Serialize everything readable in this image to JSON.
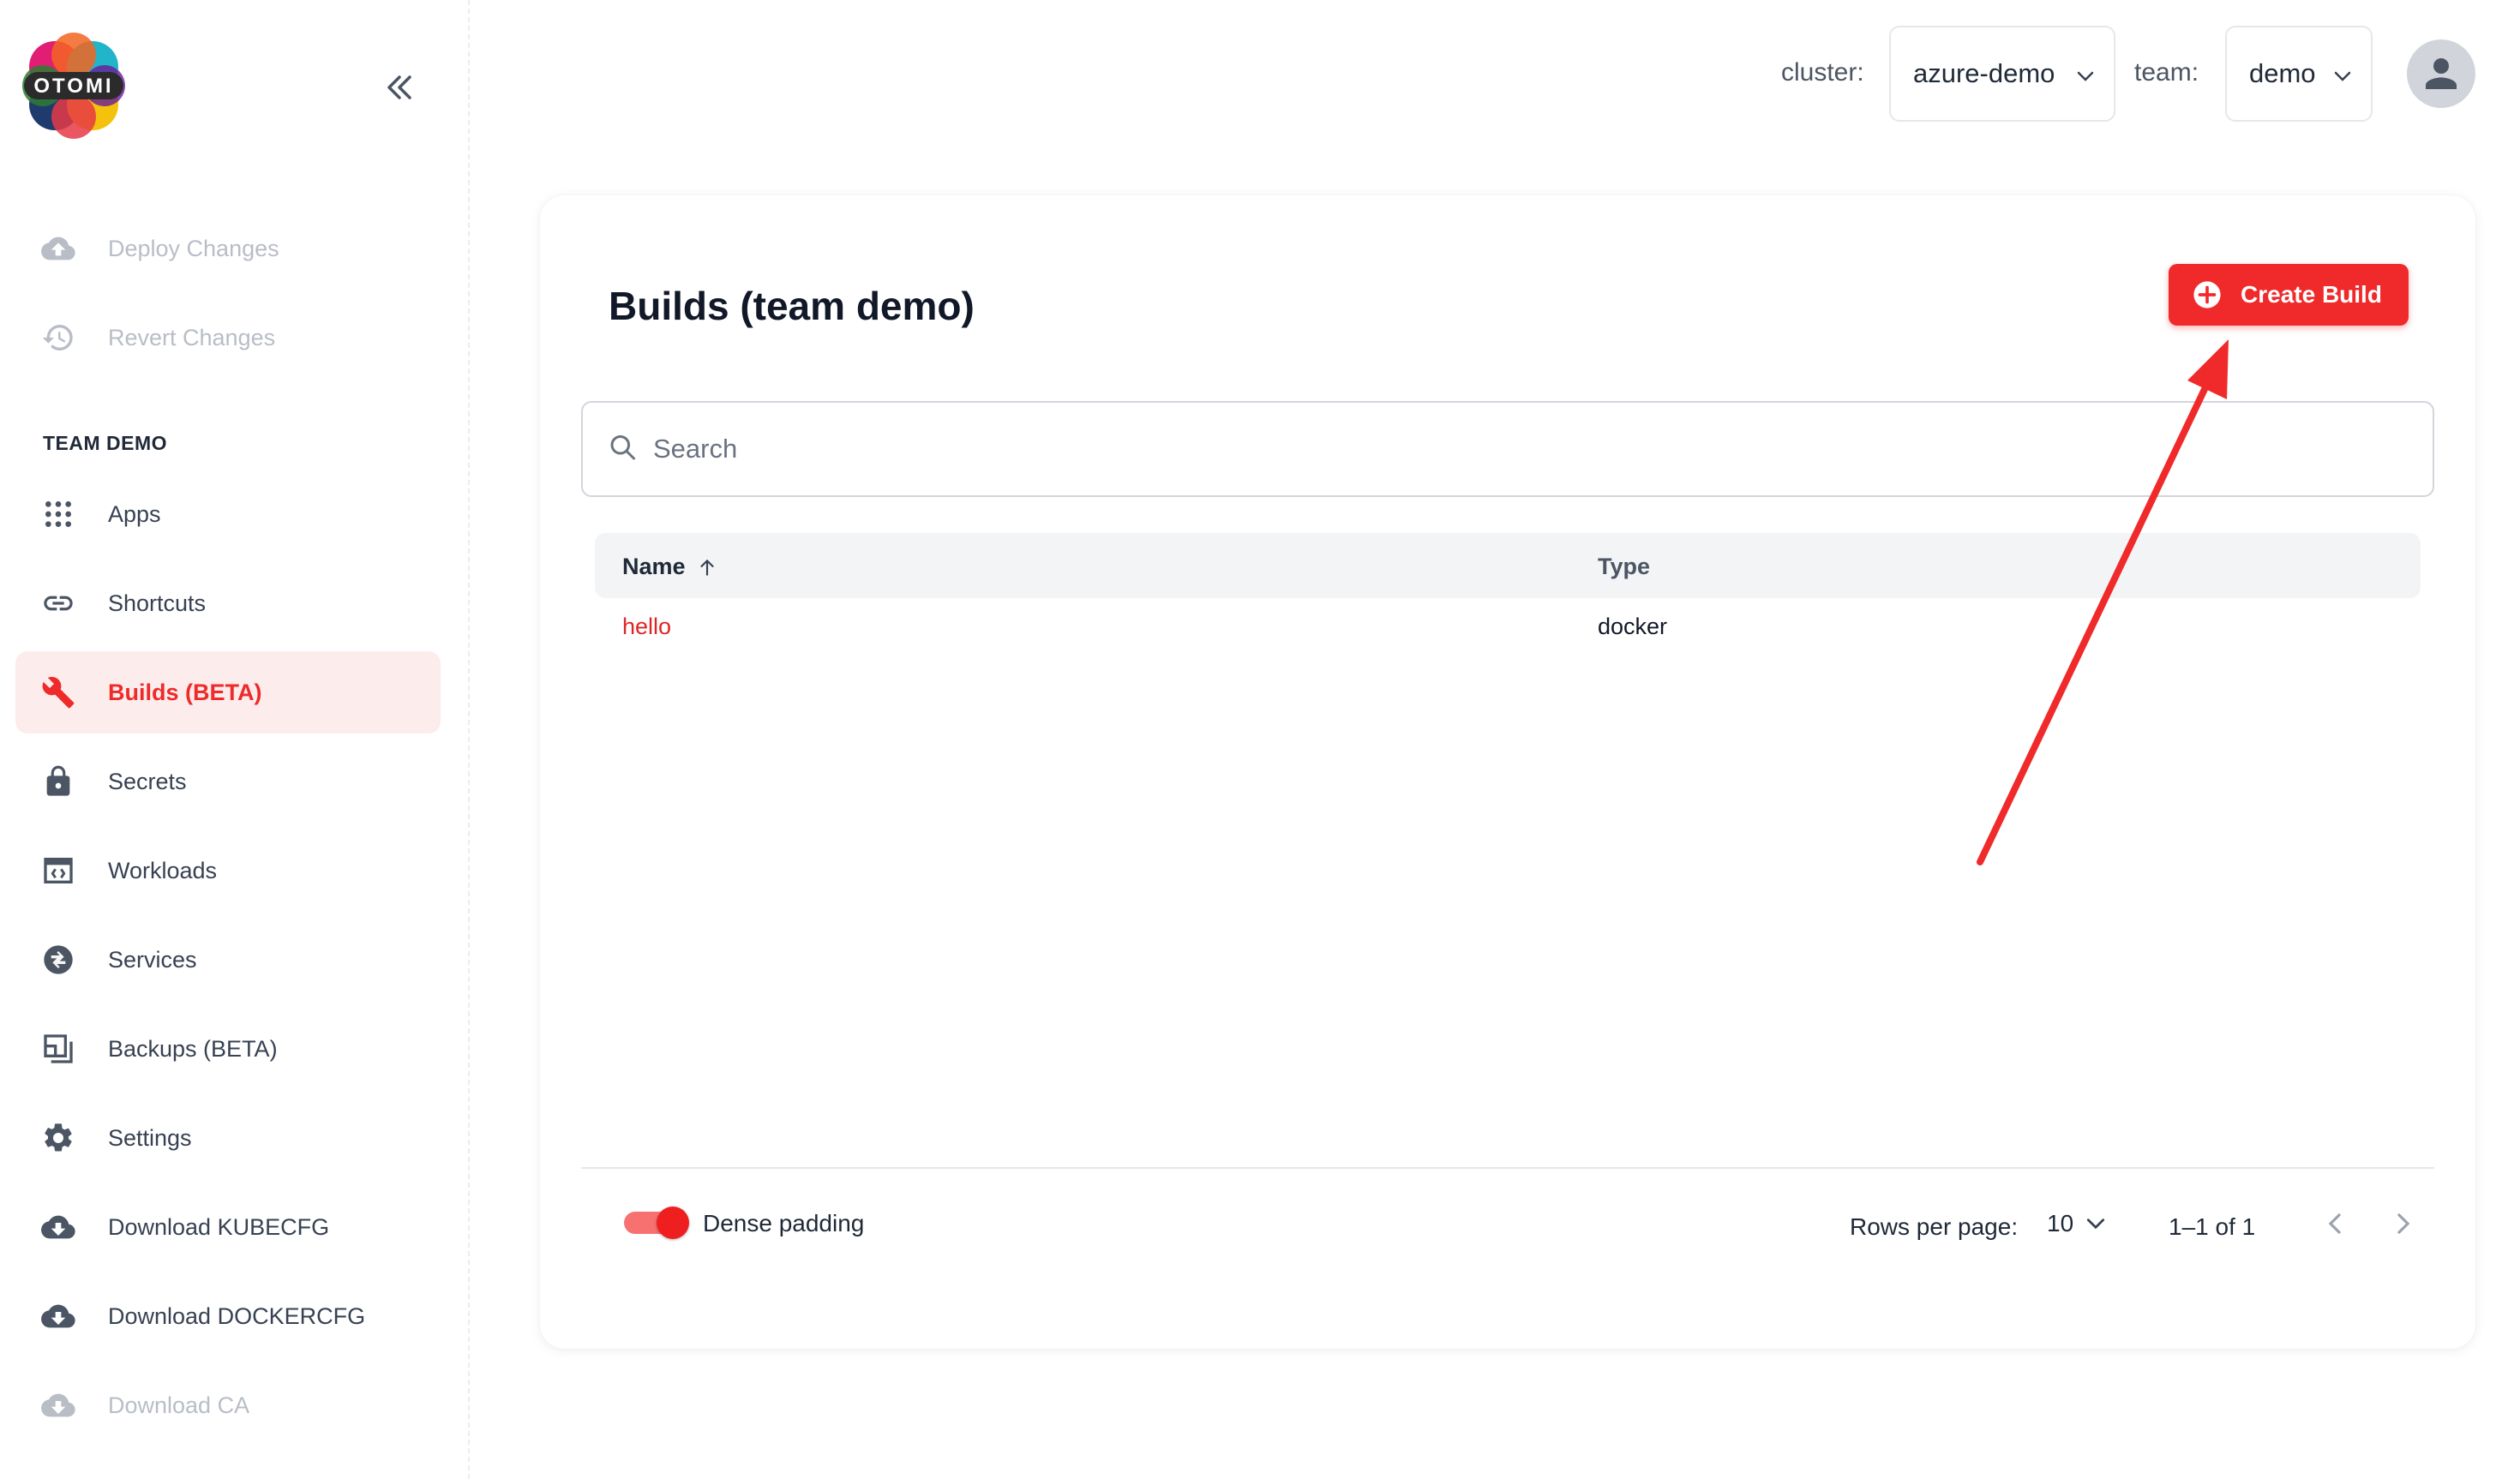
{
  "app": {
    "logo_text": "OTOMI"
  },
  "sidebar": {
    "top_items": [
      {
        "label": "Deploy Changes",
        "icon": "cloud-upload-icon"
      },
      {
        "label": "Revert Changes",
        "icon": "history-icon"
      }
    ],
    "section_label": "TEAM DEMO",
    "items": [
      {
        "label": "Apps",
        "icon": "apps-grid-icon"
      },
      {
        "label": "Shortcuts",
        "icon": "link-icon"
      },
      {
        "label": "Builds (BETA)",
        "icon": "wrench-icon",
        "active": true
      },
      {
        "label": "Secrets",
        "icon": "lock-icon"
      },
      {
        "label": "Workloads",
        "icon": "workload-icon"
      },
      {
        "label": "Services",
        "icon": "services-icon"
      },
      {
        "label": "Backups (BETA)",
        "icon": "backup-icon"
      },
      {
        "label": "Settings",
        "icon": "gear-icon"
      },
      {
        "label": "Download KUBECFG",
        "icon": "cloud-download-icon"
      },
      {
        "label": "Download DOCKERCFG",
        "icon": "cloud-download-icon"
      },
      {
        "label": "Download CA",
        "icon": "cloud-download-icon"
      }
    ]
  },
  "header": {
    "cluster_label": "cluster:",
    "cluster_value": "azure-demo",
    "team_label": "team:",
    "team_value": "demo"
  },
  "main": {
    "title": "Builds (team demo)",
    "create_button": "Create Build",
    "search_placeholder": "Search",
    "columns": [
      "Name",
      "Type"
    ],
    "rows": [
      {
        "name": "hello",
        "type": "docker"
      }
    ],
    "dense_padding_label": "Dense padding",
    "dense_padding_on": true,
    "rows_per_page_label": "Rows per page:",
    "rows_per_page": "10",
    "page_info": "1–1 of 1"
  },
  "colors": {
    "accent": "#f02a2a",
    "accent_bg": "#fdecec",
    "annotation_arrow": "#f02a2a"
  }
}
